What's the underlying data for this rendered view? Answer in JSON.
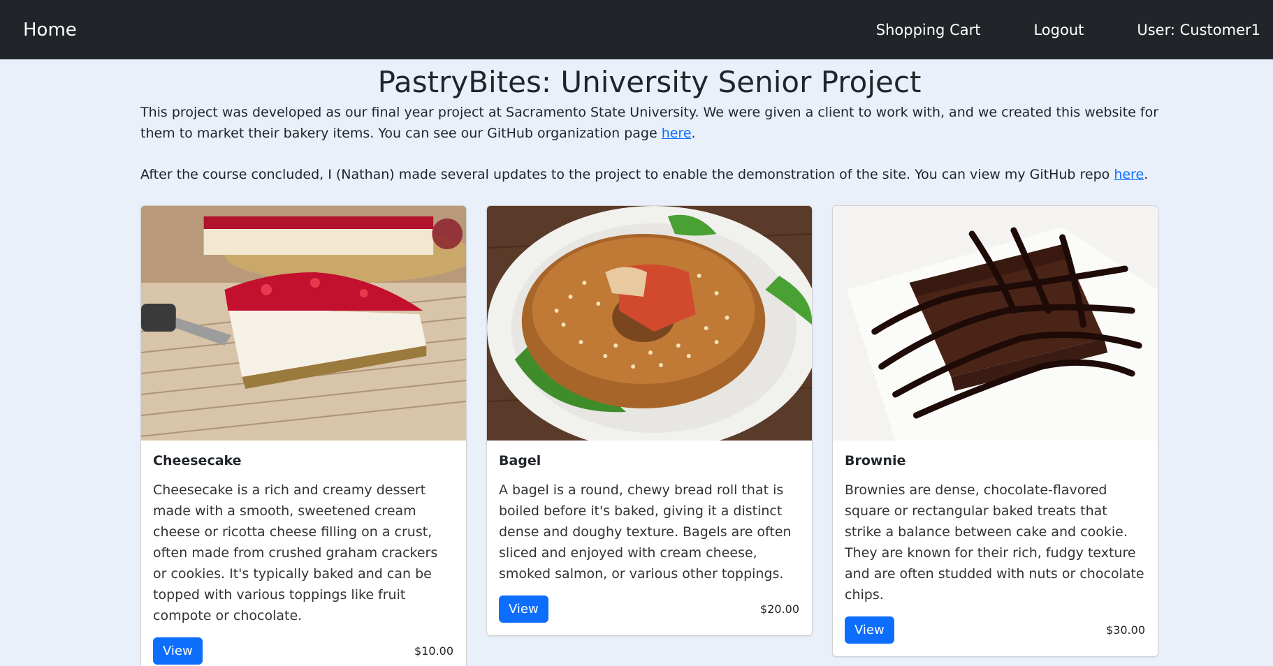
{
  "nav": {
    "brand": "Home",
    "cart": "Shopping Cart",
    "logout": "Logout",
    "user": "User: Customer1"
  },
  "page": {
    "title": "PastryBites: University Senior Project",
    "intro1": "This project was developed as our final year project at Sacramento State University. We were given a client to work with, and we created this website for them to market their bakery items. You can see our GitHub organization page ",
    "intro1_link": "here",
    "intro1_end": ".",
    "intro2": "After the course concluded, I (Nathan) made several updates to the project to enable the demonstration of the site. You can view my GitHub repo ",
    "intro2_link": "here",
    "intro2_end": "."
  },
  "products": [
    {
      "name": "Cheesecake",
      "description": "Cheesecake is a rich and creamy dessert made with a smooth, sweetened cream cheese or ricotta cheese filling on a crust, often made from crushed graham crackers or cookies. It's typically baked and can be topped with various toppings like fruit compote or chocolate.",
      "button": "View",
      "price": "$10.00"
    },
    {
      "name": "Bagel",
      "description": "A bagel is a round, chewy bread roll that is boiled before it's baked, giving it a distinct dense and doughy texture. Bagels are often sliced and enjoyed with cream cheese, smoked salmon, or various other toppings.",
      "button": "View",
      "price": "$20.00"
    },
    {
      "name": "Brownie",
      "description": "Brownies are dense, chocolate-flavored square or rectangular baked treats that strike a balance between cake and cookie. They are known for their rich, fudgy texture and are often studded with nuts or chocolate chips.",
      "button": "View",
      "price": "$30.00"
    }
  ]
}
